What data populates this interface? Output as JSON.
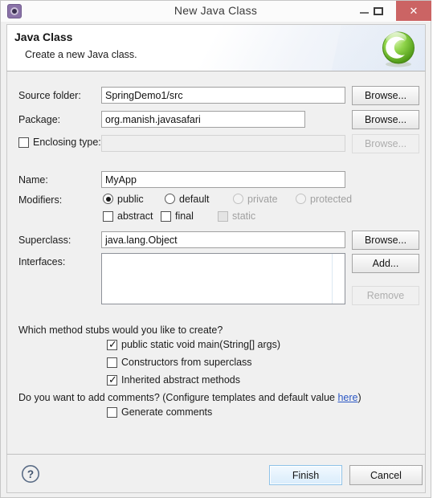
{
  "window": {
    "title": "New Java Class",
    "app_icon": "eclipse-wizard-icon",
    "controls": {
      "minimize": "–",
      "maximize": "□",
      "close": "✕"
    }
  },
  "header": {
    "title": "Java Class",
    "subtitle": "Create a new Java class.",
    "icon": "java-class-green-c-icon"
  },
  "form": {
    "source_folder": {
      "label": "Source folder:",
      "value": "SpringDemo1/src",
      "button": "Browse..."
    },
    "package": {
      "label": "Package:",
      "value": "org.manish.javasafari",
      "button": "Browse..."
    },
    "enclosing_type": {
      "label": "Enclosing type:",
      "checked": false,
      "value": "",
      "button": "Browse...",
      "enabled": false
    },
    "name": {
      "label": "Name:",
      "value": "MyApp"
    },
    "modifiers": {
      "label": "Modifiers:",
      "access": [
        {
          "label": "public",
          "selected": true,
          "enabled": true
        },
        {
          "label": "default",
          "selected": false,
          "enabled": true
        },
        {
          "label": "private",
          "selected": false,
          "enabled": false
        },
        {
          "label": "protected",
          "selected": false,
          "enabled": false
        }
      ],
      "flags": [
        {
          "label": "abstract",
          "checked": false,
          "enabled": true
        },
        {
          "label": "final",
          "checked": false,
          "enabled": true
        },
        {
          "label": "static",
          "checked": false,
          "enabled": false
        }
      ]
    },
    "superclass": {
      "label": "Superclass:",
      "value": "java.lang.Object",
      "button": "Browse..."
    },
    "interfaces": {
      "label": "Interfaces:",
      "items": [],
      "add_button": "Add...",
      "remove_button": "Remove",
      "remove_enabled": false
    }
  },
  "stubs": {
    "question": "Which method stubs would you like to create?",
    "options": [
      {
        "label": "public static void main(String[] args)",
        "checked": true
      },
      {
        "label": "Constructors from superclass",
        "checked": false
      },
      {
        "label": "Inherited abstract methods",
        "checked": true
      }
    ]
  },
  "comments": {
    "question_prefix": "Do you want to add comments? (Configure templates and default value ",
    "link": "here",
    "question_suffix": ")",
    "option": {
      "label": "Generate comments",
      "checked": false
    }
  },
  "footer": {
    "help_icon": "help-question-icon",
    "finish": "Finish",
    "cancel": "Cancel"
  },
  "colors": {
    "close_button": "#cb6464",
    "default_button_border": "#8ec2e8",
    "link": "#2b57c4",
    "dialog_background": "#f0f0f0",
    "class_icon_green": "#6ec82e"
  }
}
